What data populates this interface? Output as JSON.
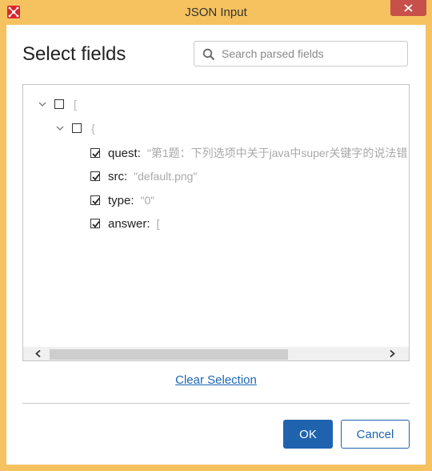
{
  "window": {
    "title": "JSON Input"
  },
  "dialog": {
    "heading": "Select fields",
    "search": {
      "placeholder": "Search parsed fields",
      "value": ""
    },
    "tree": [
      {
        "label": "[",
        "kind": "array",
        "expanded": true,
        "checked": false
      },
      {
        "label": "{",
        "kind": "object",
        "expanded": true,
        "checked": false
      },
      {
        "key": "quest:",
        "value": "\"第1题：下列选项中关于java中super关键字的说法错",
        "checked": true
      },
      {
        "key": "src:",
        "value": "\"default.png\"",
        "checked": true
      },
      {
        "key": "type:",
        "value": "\"0\"",
        "checked": true
      },
      {
        "key": "answer:",
        "value": "[",
        "checked": true
      }
    ],
    "clear_label": "Clear Selection",
    "ok_label": "OK",
    "cancel_label": "Cancel"
  },
  "colors": {
    "accent": "#1f63ae",
    "title_bar": "#f6c25f",
    "close": "#c7504a"
  }
}
